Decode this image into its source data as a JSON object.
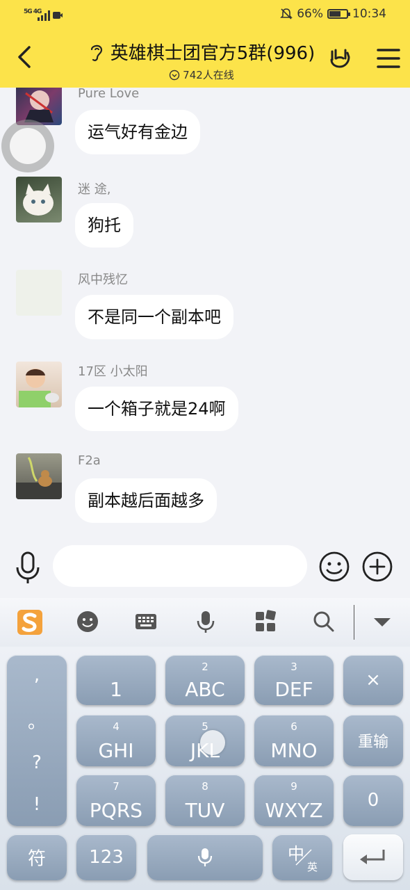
{
  "status": {
    "signal": "5G 4G",
    "battery": "66%",
    "time": "10:34",
    "battery_level": 0.66
  },
  "header": {
    "title": "英雄棋士团官方5群(996)",
    "online": "742人在线"
  },
  "messages": [
    {
      "name": "Pure Love",
      "text": "运气好有金边",
      "avatar": "anime-avatar"
    },
    {
      "name": "迷 途,",
      "text": "狗托",
      "avatar": "cat-avatar"
    },
    {
      "name": "风中残忆",
      "text": "不是同一个副本吧",
      "avatar": "blank-avatar"
    },
    {
      "name": "17区  小太阳",
      "text": "一个箱子就是24啊",
      "avatar": "baby-avatar"
    },
    {
      "name": "F2a",
      "text": "副本越后面越多",
      "avatar": "dog-avatar"
    }
  ],
  "keyboard": {
    "punct": [
      ",",
      "。",
      "?",
      "!"
    ],
    "keys": [
      {
        "num": "",
        "label": "1"
      },
      {
        "num": "2",
        "label": "ABC"
      },
      {
        "num": "3",
        "label": "DEF"
      },
      {
        "num": "",
        "label": "×"
      },
      {
        "num": "4",
        "label": "GHI"
      },
      {
        "num": "5",
        "label": "JKL"
      },
      {
        "num": "6",
        "label": "MNO"
      },
      {
        "num": "",
        "label": "重输"
      },
      {
        "num": "7",
        "label": "PQRS"
      },
      {
        "num": "8",
        "label": "TUV"
      },
      {
        "num": "9",
        "label": "WXYZ"
      },
      {
        "num": "",
        "label": "0"
      }
    ],
    "bottom": {
      "symbol": "符",
      "num": "123",
      "lang_top": "中",
      "lang_bottom": "英"
    }
  },
  "colors": {
    "header_bg": "#fce34a",
    "chat_bg": "#f2f3f7",
    "key": "#9aabbf"
  }
}
